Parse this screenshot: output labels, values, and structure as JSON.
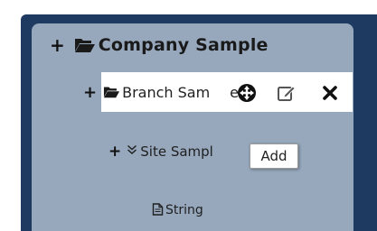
{
  "tree": {
    "company": {
      "expand_symbol": "+",
      "icon": "open-folder-icon",
      "label": "Company Sample"
    },
    "branch": {
      "expand_symbol": "+",
      "icon": "open-folder-icon",
      "label": "Branch Sam",
      "label_tail": "e",
      "actions": {
        "move_icon": "move-icon",
        "edit_icon": "edit-icon",
        "delete_icon": "close-icon"
      }
    },
    "site": {
      "expand_symbol": "+",
      "icon": "double-chevron-down-icon",
      "label": "Site Sampl"
    },
    "string": {
      "icon": "document-icon",
      "label": "String"
    }
  },
  "tooltip": {
    "text": "Add"
  },
  "colors": {
    "outer_frame": "#1e3a60",
    "panel": "#97a8bd",
    "selected_row": "#ffffff"
  }
}
